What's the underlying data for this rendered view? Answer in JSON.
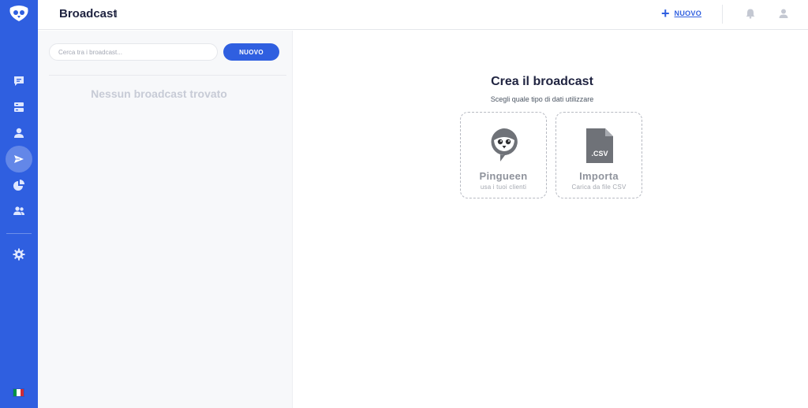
{
  "header": {
    "title": "Broadcast",
    "new_label": "NUOVO"
  },
  "sidebar": {
    "logo": "pingueen-logo",
    "items": [
      {
        "name": "chat-icon"
      },
      {
        "name": "server-icon"
      },
      {
        "name": "user-icon"
      },
      {
        "name": "send-icon",
        "active": true
      },
      {
        "name": "pie-chart-icon"
      },
      {
        "name": "users-icon"
      },
      {
        "name": "gear-icon"
      }
    ],
    "language_flag": "italian-flag"
  },
  "list_panel": {
    "search_placeholder": "Cerca tra i broadcast...",
    "new_button": "NUOVO",
    "empty_message": "Nessun broadcast trovato"
  },
  "main": {
    "title": "Crea il broadcast",
    "subtitle": "Scegli quale tipo di dati utilizzare",
    "options": [
      {
        "title": "Pingueen",
        "subtitle": "usa i tuoi clienti",
        "icon": "pingueen-icon"
      },
      {
        "title": "Importa",
        "subtitle": "Carica da file CSV",
        "icon": "csv-file-icon",
        "icon_text": ".CSV"
      }
    ]
  },
  "colors": {
    "accent": "#2f5fe0",
    "sidebar": "#2f5fe0",
    "title": "#1f2340",
    "muted": "#c7cbd6"
  }
}
